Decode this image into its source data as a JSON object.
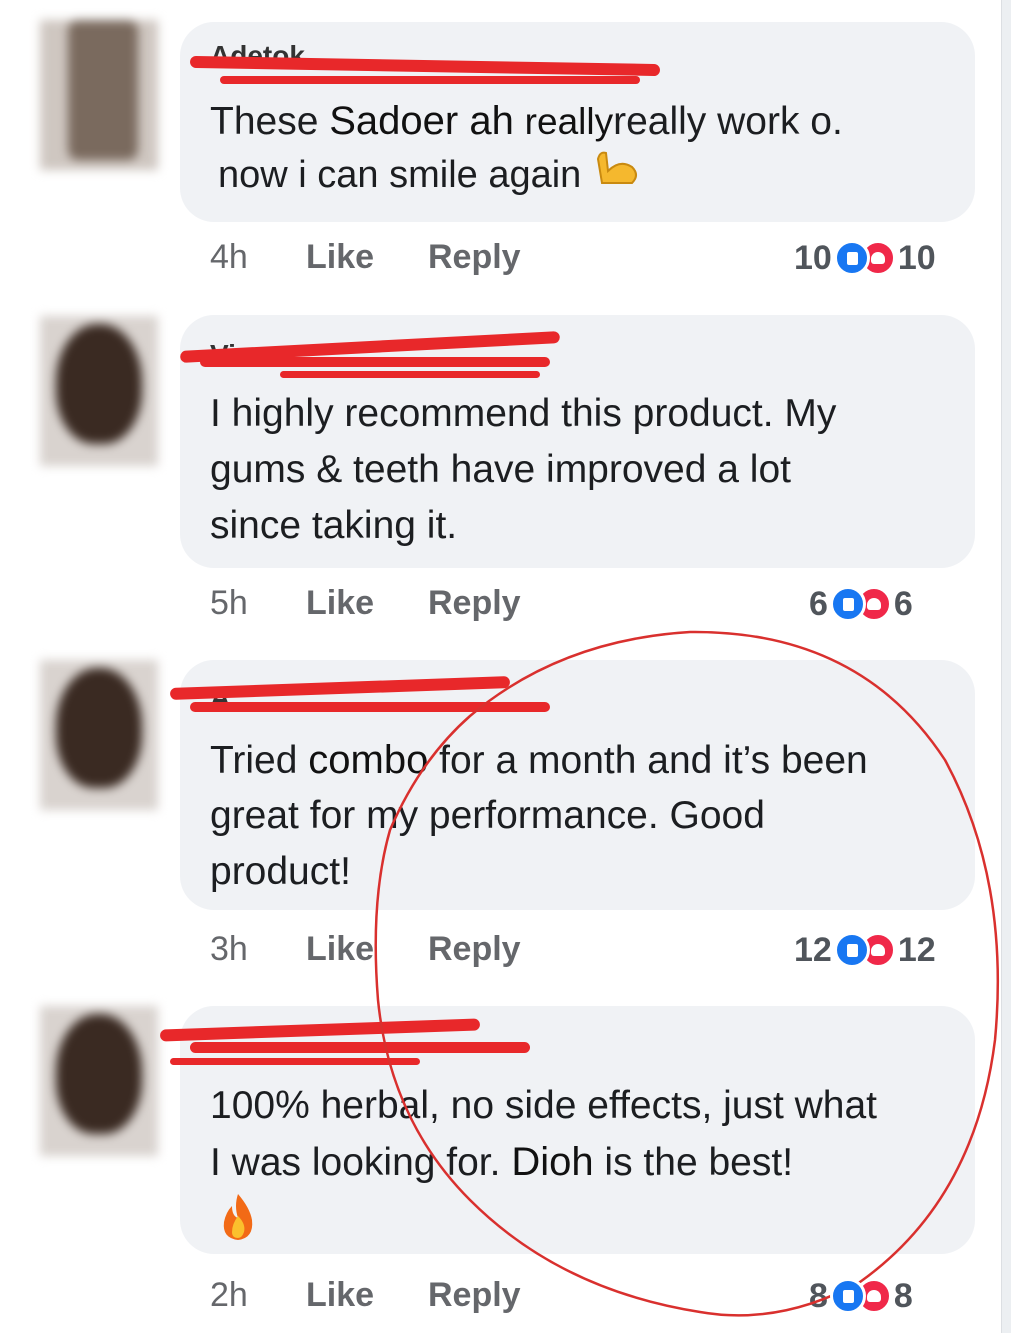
{
  "comments": [
    {
      "author": "Adetok",
      "line1_pre": "These ",
      "line1_insert": "Sadoer ah",
      "line1_insert2": "really",
      "line1_post": "really work o.",
      "line2": "now i can smile again",
      "emoji": "flexed-biceps-icon",
      "time": "4h",
      "like_label": "Like",
      "reply_label": "Reply",
      "like_count": "10",
      "love_count": "10"
    },
    {
      "author": "Vi",
      "lines": [
        "I highly recommend this product. My",
        "gums & teeth have improved a lot",
        "since taking it."
      ],
      "time": "5h",
      "like_label": "Like",
      "reply_label": "Reply",
      "like_count": "6",
      "love_count": "6"
    },
    {
      "author": "A",
      "line1_pre": "Tried ",
      "line1_insert": "combo",
      "line1_post": " for a month and it’s been",
      "line2": "great for my performance. Good",
      "line3": "product!",
      "time": "3h",
      "like_label": "Like",
      "reply_label": "Reply",
      "like_count": "12",
      "love_count": "12"
    },
    {
      "author": "",
      "line1": "100% herbal, no side effects, just what",
      "line2_pre": "I was looking for.  ",
      "line2_insert": "Dioh",
      "line2_post": "  is the best!",
      "emoji": "fire-icon",
      "time": "2h",
      "like_label": "Like",
      "reply_label": "Reply",
      "like_count": "8",
      "love_count": "8"
    }
  ],
  "colors": {
    "bubble": "#f0f2f5",
    "like": "#1877f2",
    "love": "#f02849",
    "scribble": "#e8282a",
    "circle": "#d9302e"
  }
}
